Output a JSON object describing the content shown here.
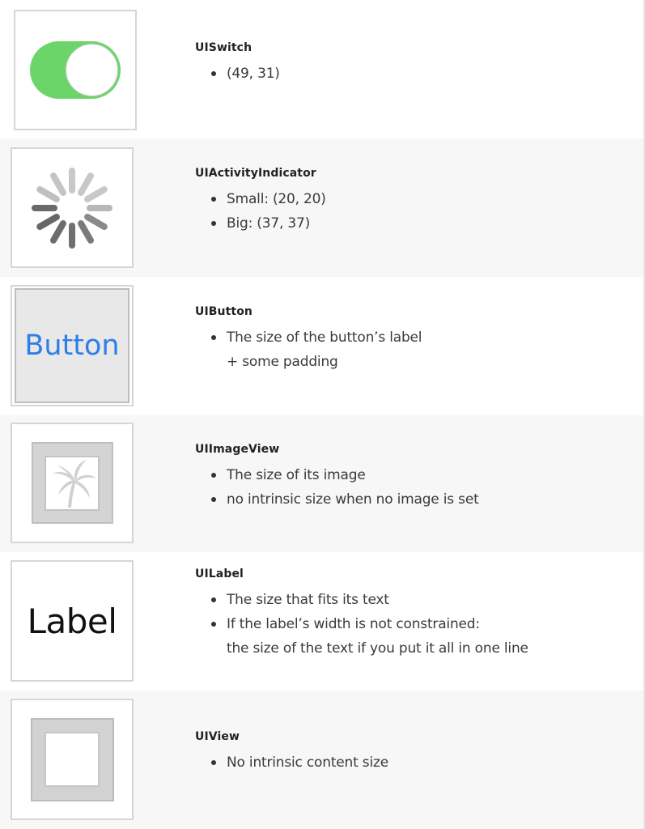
{
  "items": [
    {
      "title": "UISwitch",
      "bullets": [
        "(49, 31)"
      ]
    },
    {
      "title": "UIActivityIndicator",
      "bullets": [
        "Small: (20, 20)",
        "Big: (37, 37)"
      ]
    },
    {
      "title": "UIButton",
      "bullets": [
        "The size of the button’s label",
        "+ some padding"
      ],
      "button_label": "Button",
      "button_color": "#2f7ee8"
    },
    {
      "title": "UIImageView",
      "bullets": [
        "The size of its image",
        "no intrinsic size when no image is set"
      ]
    },
    {
      "title": "UILabel",
      "bullets": [
        "The size that fits its text",
        "If the label’s width is not constrained:",
        "the size of the text if you put it all in one line"
      ],
      "label_sample": "Label"
    },
    {
      "title": "UIView",
      "bullets": [
        "No intrinsic content size"
      ]
    }
  ],
  "colors": {
    "switch_on": "#6cd56a",
    "row_alt": "#f7f7f7",
    "thumb_border": "#d6d6d6"
  },
  "icons": [
    "switch-icon",
    "activity-indicator-icon",
    "palm-tree-image-icon"
  ]
}
